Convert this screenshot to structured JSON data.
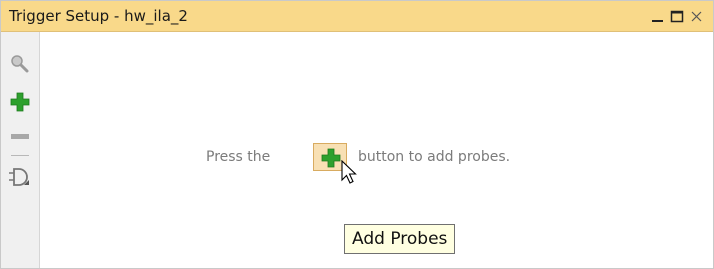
{
  "window": {
    "title": "Trigger Setup - hw_ila_2"
  },
  "titlebar_buttons": {
    "minimize_icon": "minimize-icon",
    "maximize_icon": "maximize-icon",
    "close_icon": "close-icon"
  },
  "toolbar": {
    "items": [
      {
        "name": "search-icon",
        "enabled": false
      },
      {
        "name": "add-probe-icon",
        "enabled": true
      },
      {
        "name": "remove-probe-icon",
        "enabled": false
      },
      {
        "name": "gate-icon",
        "enabled": false
      }
    ]
  },
  "content": {
    "hint_before": "Press the",
    "hint_after": "button to add probes.",
    "inline_button_icon": "add-icon"
  },
  "tooltip": {
    "text": "Add Probes"
  },
  "colors": {
    "titlebar_bg": "#f9d98a",
    "add_green": "#2ea02e",
    "hint_text": "#7b7b7b",
    "tooltip_bg": "#ffffe1"
  }
}
